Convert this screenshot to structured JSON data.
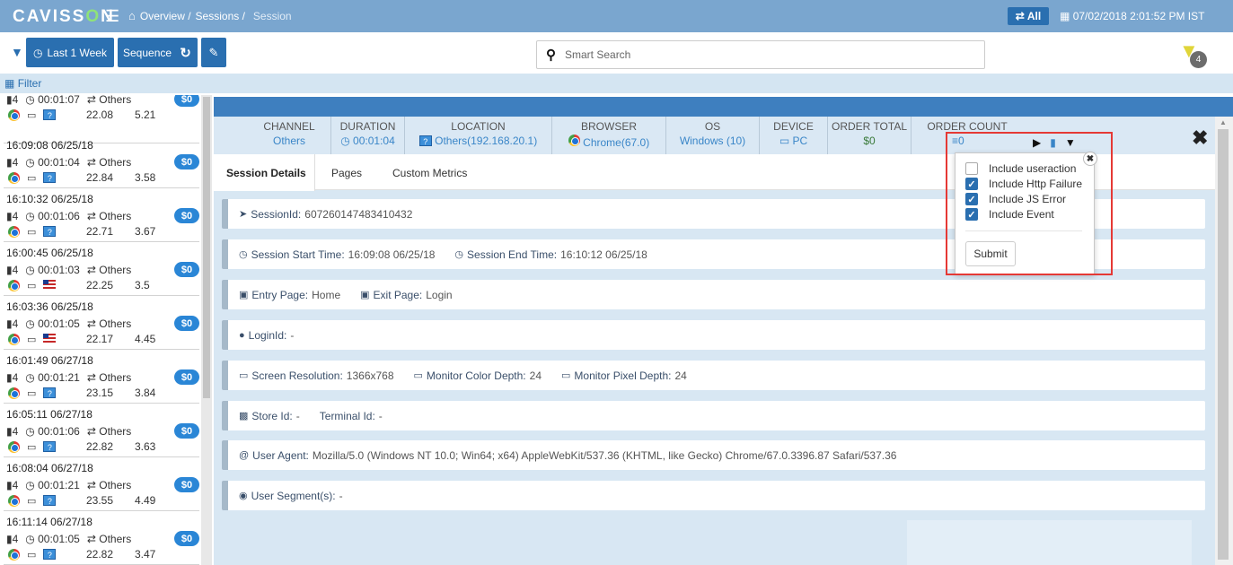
{
  "header": {
    "logo_pre": "CAVISS",
    "logo_o": "O",
    "logo_post": "N",
    "breadcrumb": [
      "Overview /",
      "Sessions /",
      "Session"
    ],
    "all_button": "All",
    "datetime": "07/02/2018 2:01:52 PM IST"
  },
  "toolbar": {
    "range_label": "Last 1 Week",
    "sequence_label": "Sequence",
    "search_placeholder": "Smart Search",
    "filter_count": "4"
  },
  "filterbar": {
    "label": "Filter"
  },
  "sessions": [
    {
      "time": "",
      "pages": "4",
      "duration": "00:01:07",
      "channel": "Others",
      "flag": "q",
      "m1": "22.08",
      "m2": "5.21",
      "amount": "$0"
    },
    {
      "time": "16:09:08 06/25/18",
      "pages": "4",
      "duration": "00:01:04",
      "channel": "Others",
      "flag": "q",
      "m1": "22.84",
      "m2": "3.58",
      "amount": "$0"
    },
    {
      "time": "16:10:32 06/25/18",
      "pages": "4",
      "duration": "00:01:06",
      "channel": "Others",
      "flag": "q",
      "m1": "22.71",
      "m2": "3.67",
      "amount": "$0"
    },
    {
      "time": "16:00:45 06/25/18",
      "pages": "4",
      "duration": "00:01:03",
      "channel": "Others",
      "flag": "us",
      "m1": "22.25",
      "m2": "3.5",
      "amount": "$0"
    },
    {
      "time": "16:03:36 06/25/18",
      "pages": "4",
      "duration": "00:01:05",
      "channel": "Others",
      "flag": "us",
      "m1": "22.17",
      "m2": "4.45",
      "amount": "$0"
    },
    {
      "time": "16:01:49 06/27/18",
      "pages": "4",
      "duration": "00:01:21",
      "channel": "Others",
      "flag": "q",
      "m1": "23.15",
      "m2": "3.84",
      "amount": "$0"
    },
    {
      "time": "16:05:11 06/27/18",
      "pages": "4",
      "duration": "00:01:06",
      "channel": "Others",
      "flag": "q",
      "m1": "22.82",
      "m2": "3.63",
      "amount": "$0"
    },
    {
      "time": "16:08:04 06/27/18",
      "pages": "4",
      "duration": "00:01:21",
      "channel": "Others",
      "flag": "q",
      "m1": "23.55",
      "m2": "4.49",
      "amount": "$0"
    },
    {
      "time": "16:11:14 06/27/18",
      "pages": "4",
      "duration": "00:01:05",
      "channel": "Others",
      "flag": "q",
      "m1": "22.82",
      "m2": "3.47",
      "amount": "$0"
    }
  ],
  "summary": {
    "channel": {
      "h": "CHANNEL",
      "v": "Others"
    },
    "duration": {
      "h": "DURATION",
      "v": "00:01:04"
    },
    "location": {
      "h": "LOCATION",
      "v": "Others(192.168.20.1)"
    },
    "browser": {
      "h": "BROWSER",
      "v": "Chrome(67.0)"
    },
    "os": {
      "h": "OS",
      "v": "Windows (10)"
    },
    "device": {
      "h": "DEVICE",
      "v": "PC"
    },
    "order_total": {
      "h": "ORDER TOTAL",
      "v": "$0"
    },
    "order_count": {
      "h": "ORDER COUNT",
      "v": "0"
    }
  },
  "tabs": [
    "Session Details",
    "Pages",
    "Custom Metrics"
  ],
  "details": {
    "session_id_k": "SessionId:",
    "session_id_v": "607260147483410432",
    "start_k": "Session Start Time:",
    "start_v": "16:09:08 06/25/18",
    "end_k": "Session End Time:",
    "end_v": "16:10:12 06/25/18",
    "entry_k": "Entry Page:",
    "entry_v": "Home",
    "exit_k": "Exit Page:",
    "exit_v": "Login",
    "login_k": "LoginId:",
    "login_v": "-",
    "res_k": "Screen Resolution:",
    "res_v": "1366x768",
    "color_k": "Monitor Color Depth:",
    "color_v": "24",
    "pixel_k": "Monitor Pixel Depth:",
    "pixel_v": "24",
    "store_k": "Store Id:",
    "store_v": "-",
    "terminal_k": "Terminal Id:",
    "terminal_v": "-",
    "ua_k": "User Agent:",
    "ua_v": "Mozilla/5.0 (Windows NT 10.0; Win64; x64) AppleWebKit/537.36 (KHTML, like Gecko) Chrome/67.0.3396.87 Safari/537.36",
    "segment_k": "User Segment(s):",
    "segment_v": "-"
  },
  "popover": {
    "options": [
      {
        "label": "Include useraction",
        "checked": false
      },
      {
        "label": "Include Http Failure",
        "checked": true
      },
      {
        "label": "Include JS Error",
        "checked": true
      },
      {
        "label": "Include Event",
        "checked": true
      }
    ],
    "submit": "Submit"
  },
  "colors": {
    "header_bg": "#7aa6cf",
    "primary": "#2a6fb0",
    "highlight": "#e53935",
    "panel_bg": "#d8e7f3"
  }
}
